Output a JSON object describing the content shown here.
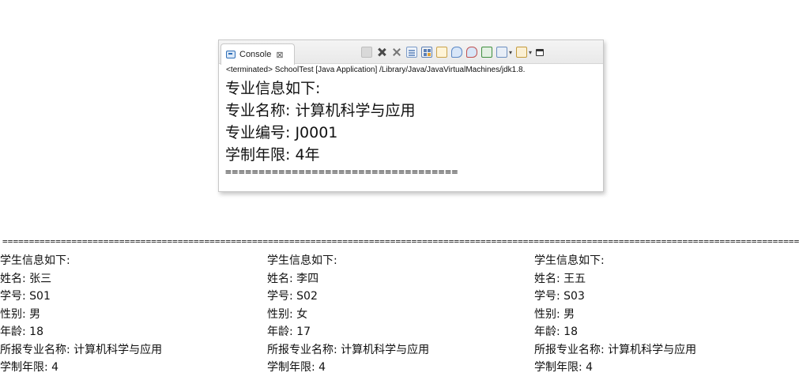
{
  "console": {
    "tab_label": "Console",
    "tab_close": "⊠",
    "status": "<terminated> SchoolTest [Java Application] /Library/Java/JavaVirtualMachines/jdk1.8.",
    "lines": [
      "专业信息如下:",
      "专业名称: 计算机科学与应用",
      "专业编号: J0001",
      "学制年限: 4年"
    ],
    "separator": "===================================",
    "toolbar_icons": [
      "terminate-icon",
      "remove-launch-icon",
      "remove-all-icon",
      "scroll-lock-icon",
      "word-wrap-icon",
      "pin-console-icon",
      "show-when-stdout-icon",
      "show-when-stderr-icon",
      "new-console-icon",
      "display-console-icon",
      "open-console-icon",
      "restore-icon"
    ]
  },
  "output": {
    "separator_line": "========================================================================================================================================================================",
    "students": [
      {
        "header": "学生信息如下:",
        "name": "姓名: 张三",
        "id": "学号: S01",
        "gender": "性别: 男",
        "age": "年龄: 18",
        "major": "所报专业名称: 计算机科学与应用",
        "years": "学制年限: 4"
      },
      {
        "header": "学生信息如下:",
        "name": "姓名: 李四",
        "id": "学号: S02",
        "gender": "性别: 女",
        "age": "年龄: 17",
        "major": "所报专业名称: 计算机科学与应用",
        "years": "学制年限: 4"
      },
      {
        "header": "学生信息如下:",
        "name": "姓名: 王五",
        "id": "学号: S03",
        "gender": "性别: 男",
        "age": "年龄: 18",
        "major": "所报专业名称: 计算机科学与应用",
        "years": "学制年限: 4"
      }
    ]
  }
}
